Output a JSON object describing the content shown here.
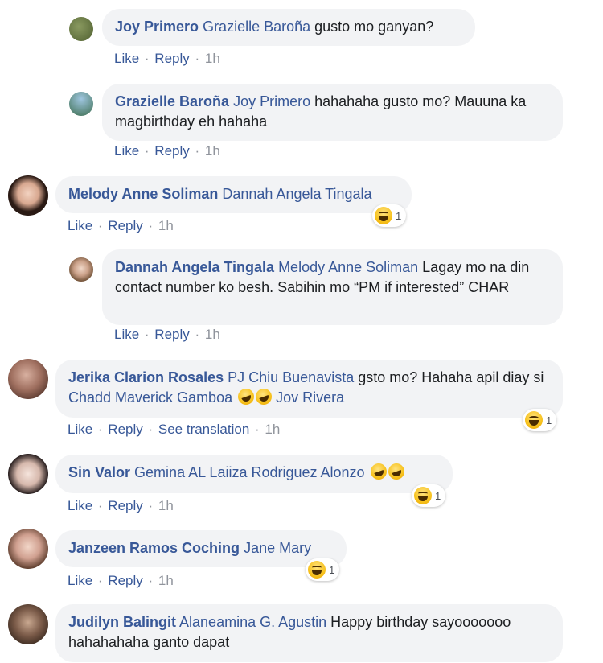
{
  "comments": [
    {
      "author": "Joy Primero",
      "mentions": [
        "Grazielle Baroña"
      ],
      "text": " gusto mo ganyan?",
      "actions": {
        "like": "Like",
        "reply": "Reply",
        "time": "1h"
      },
      "avatar_color": "#6b7b45"
    },
    {
      "author": "Grazielle Baroña",
      "mentions": [
        "Joy Primero"
      ],
      "text": " hahahaha gusto mo? Mauuna ka magbirthday eh hahaha",
      "actions": {
        "like": "Like",
        "reply": "Reply",
        "time": "1h"
      },
      "avatar_color": "#4a7ea8"
    },
    {
      "author": "Melody Anne Soliman",
      "mentions": [
        "Dannah Angela Tingala"
      ],
      "text": "",
      "actions": {
        "like": "Like",
        "reply": "Reply",
        "time": "1h"
      },
      "reaction_count": "1",
      "avatar_color": "#3a2a24"
    },
    {
      "author": "Dannah Angela Tingala",
      "mentions": [
        "Melody Anne Soliman"
      ],
      "text": " Lagay mo na din contact number ko besh. Sabihin mo “PM if interested” CHAR",
      "actions": {
        "like": "Like",
        "reply": "Reply",
        "time": "1h"
      },
      "avatar_color": "#c7a48a"
    },
    {
      "author": "Jerika Clarion Rosales",
      "mentions": [
        "PJ Chiu Buenavista",
        "Chadd Maverick Gamboa",
        "Jov Rivera"
      ],
      "text_1": " gsto mo? Hahaha apil diay si ",
      "text_2": " ",
      "actions": {
        "like": "Like",
        "reply": "Reply",
        "translate": "See translation",
        "time": "1h"
      },
      "reaction_count": "1",
      "avatar_color": "#b08070"
    },
    {
      "author": "Sin Valor",
      "mentions": [
        "Gemina AL Laiiza Rodriguez Alonzo"
      ],
      "text": " ",
      "actions": {
        "like": "Like",
        "reply": "Reply",
        "time": "1h"
      },
      "reaction_count": "1",
      "avatar_color": "#d9c2b8"
    },
    {
      "author": "Janzeen Ramos Coching",
      "mentions": [
        "Jane Mary"
      ],
      "text": "",
      "actions": {
        "like": "Like",
        "reply": "Reply",
        "time": "1h"
      },
      "reaction_count": "1",
      "avatar_color": "#c99a8a"
    },
    {
      "author": "Judilyn Balingit",
      "mentions": [
        "Alaneamina G. Agustin"
      ],
      "text": " Happy birthday sayooooooo hahahahaha ganto dapat",
      "avatar_color": "#6a5040"
    }
  ],
  "colors": {
    "name_blue": "#385898",
    "bubble_bg": "#f2f3f5",
    "meta_gray": "#90949c"
  }
}
